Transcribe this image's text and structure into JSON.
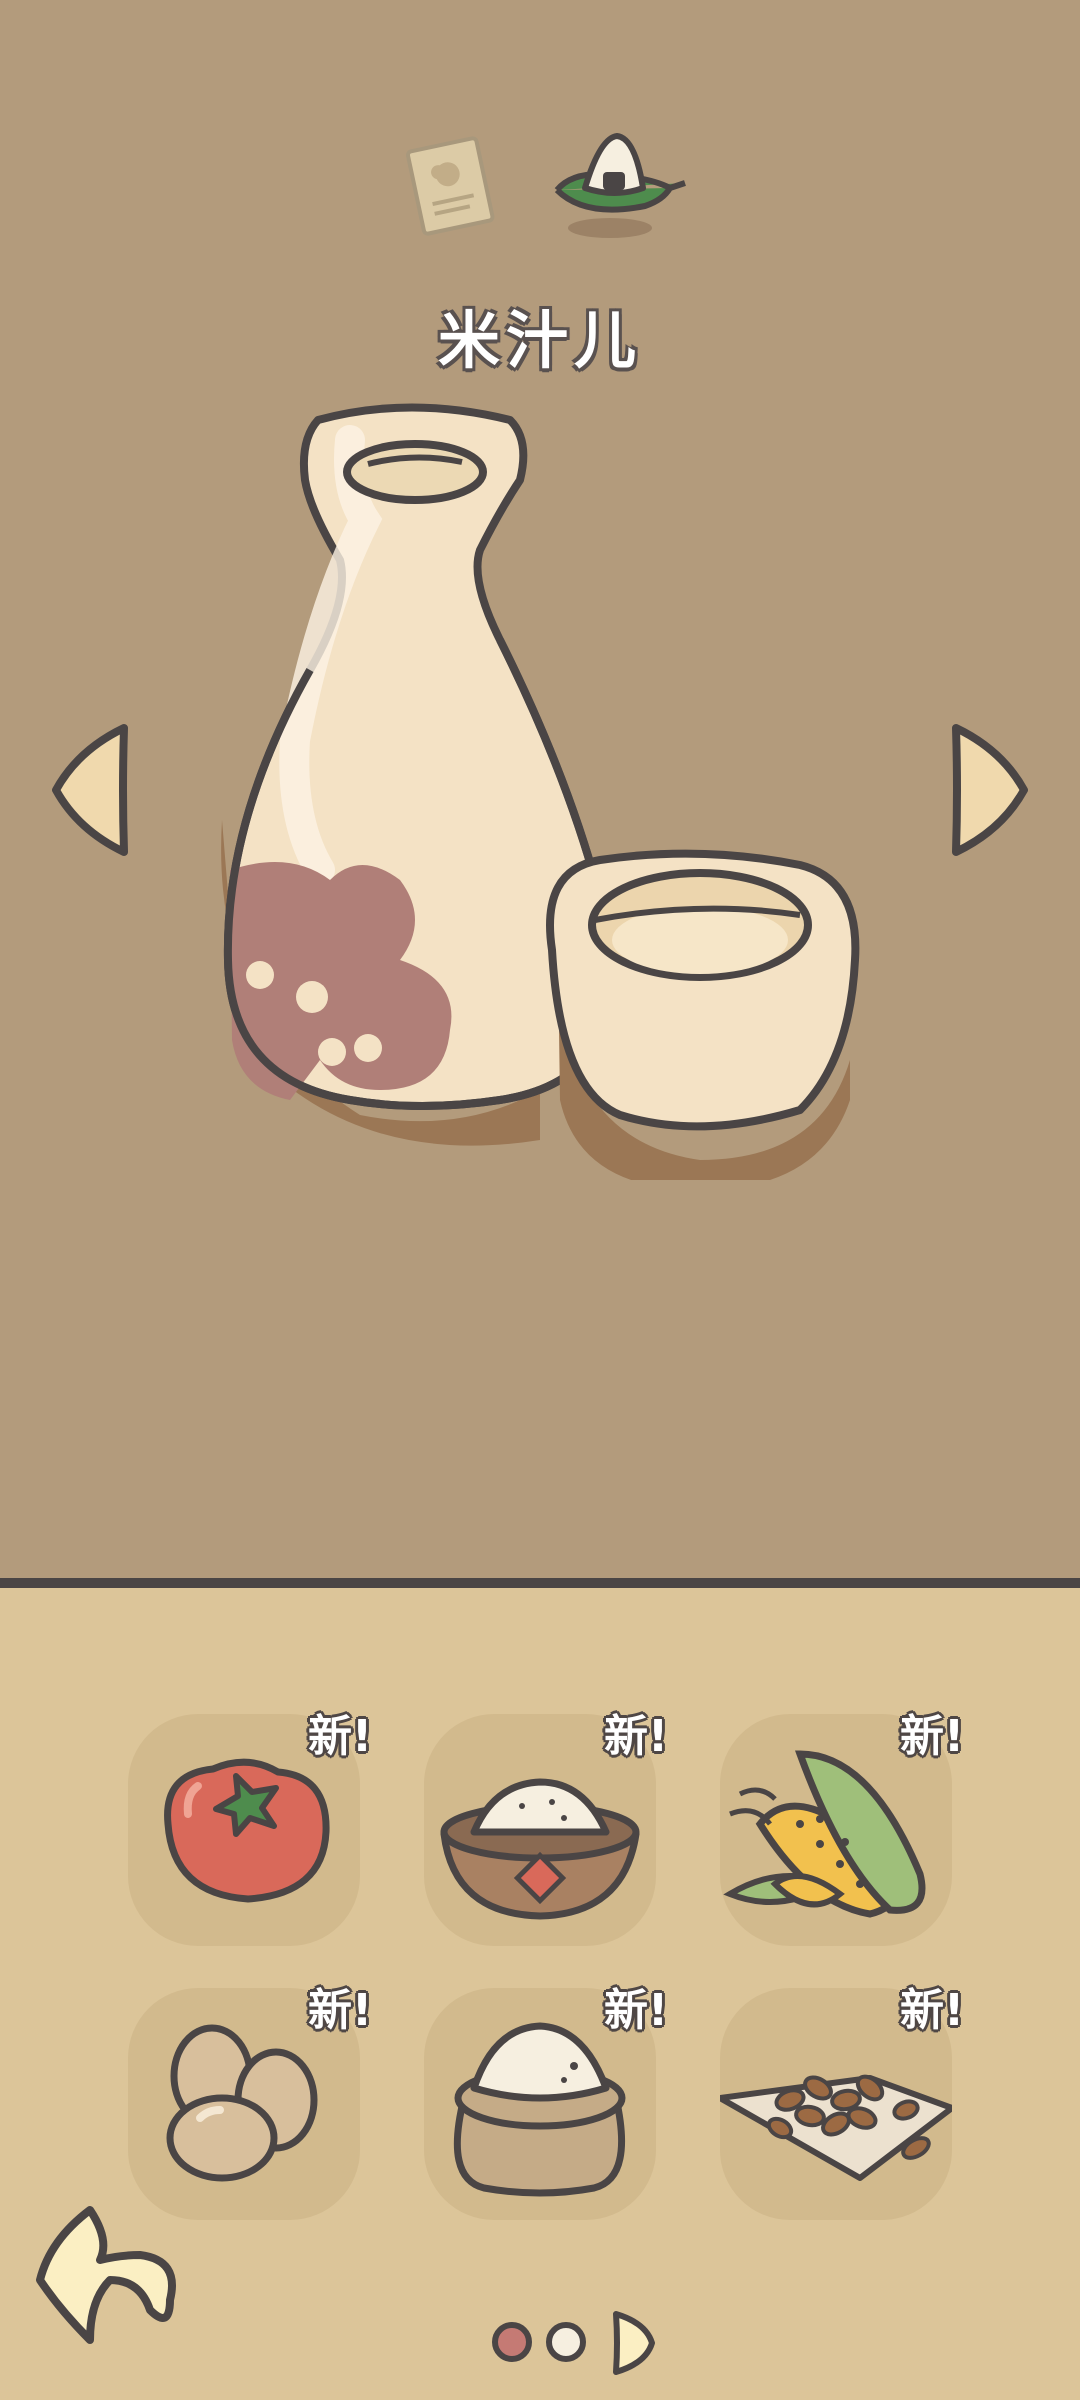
{
  "header": {
    "icons": [
      "recipe-card-icon",
      "rice-ball-icon"
    ],
    "title": "米汁儿"
  },
  "main": {
    "item_icon": "sake-bottle-and-cup-icon",
    "nav": {
      "prev": "left-arrow-icon",
      "next": "right-arrow-icon"
    }
  },
  "ingredients": {
    "items": [
      {
        "name": "tomato-icon",
        "badge": "新!"
      },
      {
        "name": "flour-bowl-icon",
        "badge": "新!"
      },
      {
        "name": "corn-icon",
        "badge": "新!"
      },
      {
        "name": "eggs-icon",
        "badge": "新!"
      },
      {
        "name": "rice-sack-icon",
        "badge": "新!"
      },
      {
        "name": "seeds-icon",
        "badge": "新!"
      }
    ]
  },
  "footer": {
    "back": "back-arrow-icon",
    "page_dots": 2,
    "active_page": 1
  },
  "colors": {
    "top_bg": "#b39b7c",
    "bottom_bg": "#dcc599",
    "outline": "#4a4545",
    "cream": "#f5e4c4"
  }
}
